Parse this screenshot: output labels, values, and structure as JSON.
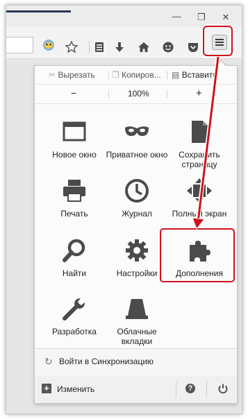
{
  "window": {
    "minimize_glyph": "—",
    "restore_glyph": "❐",
    "close_glyph": "✕"
  },
  "toolbar": {
    "icons": [
      "addon-badge-icon",
      "bookmark-star-icon",
      "bookmarks-library-icon",
      "downloads-icon",
      "home-icon",
      "chat-icon",
      "pocket-icon",
      "hamburger-menu-icon"
    ]
  },
  "menu": {
    "edit": {
      "cut": "Вырезать",
      "copy": "Копиров...",
      "paste": "Вставить"
    },
    "zoom": {
      "minus": "−",
      "level": "100%",
      "plus": "+"
    },
    "items": [
      {
        "label": "Новое окно",
        "icon": "new-window-icon"
      },
      {
        "label": "Приватное окно",
        "icon": "private-mask-icon"
      },
      {
        "label": "Сохранить страницу",
        "icon": "save-page-icon"
      },
      {
        "label": "Печать",
        "icon": "print-icon"
      },
      {
        "label": "Журнал",
        "icon": "history-clock-icon"
      },
      {
        "label": "Полный экран",
        "icon": "fullscreen-icon"
      },
      {
        "label": "Найти",
        "icon": "find-magnifier-icon"
      },
      {
        "label": "Настройки",
        "icon": "settings-gear-icon"
      },
      {
        "label": "Дополнения",
        "icon": "addons-puzzle-icon"
      },
      {
        "label": "Разработка",
        "icon": "developer-wrench-icon"
      },
      {
        "label": "Облачные вкладки",
        "icon": "cloud-tabs-icon"
      }
    ],
    "sync_label": "Войти в Синхронизацию",
    "customize_label": "Изменить"
  },
  "colors": {
    "highlight": "#d20f1e",
    "icon": "#4b4b4b"
  }
}
